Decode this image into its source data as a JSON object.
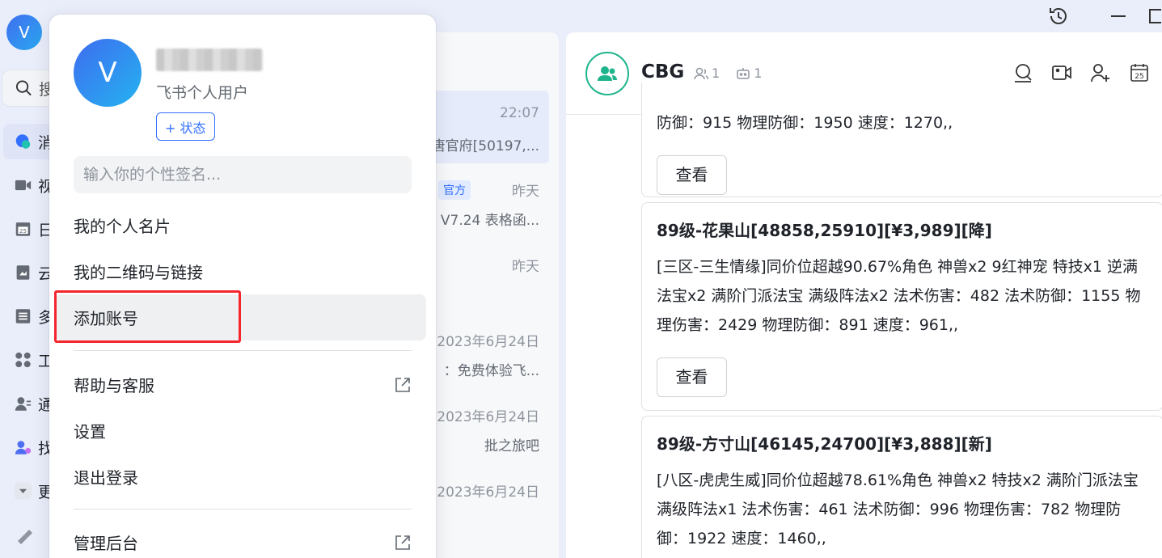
{
  "window": {
    "history_icon": "history-icon",
    "minimize_icon": "minimize-icon",
    "maximize_icon": "maximize-icon"
  },
  "rail": {
    "avatar_letter": "V",
    "search_label": "搜",
    "items": [
      {
        "icon": "messages-icon",
        "label": "消"
      },
      {
        "icon": "video-icon",
        "label": "视"
      },
      {
        "icon": "calendar-icon",
        "label": "日"
      },
      {
        "icon": "docs-icon",
        "label": "云"
      },
      {
        "icon": "list-icon",
        "label": "多"
      },
      {
        "icon": "apps-icon",
        "label": "工"
      },
      {
        "icon": "contacts-icon",
        "label": "通"
      },
      {
        "icon": "add-contact-icon",
        "label": "找"
      },
      {
        "icon": "more-icon",
        "label": "更"
      },
      {
        "icon": "pin-icon",
        "label": ""
      }
    ]
  },
  "chatlist": {
    "rows": [
      {
        "time": "22:07",
        "snippet": "唐官府[50197,..."
      },
      {
        "badge": "官方",
        "time": "昨天",
        "snippet": "V7.24 表格函..."
      },
      {
        "time": "昨天",
        "snippet": ""
      },
      {
        "time": "2023年6月24日",
        "snippet": "：免费体验飞..."
      },
      {
        "time": "2023年6月24日",
        "snippet": "批之旅吧"
      },
      {
        "time": "2023年6月24日",
        "snippet": ""
      }
    ]
  },
  "chat": {
    "group_avatar_icon": "group-icon",
    "name": "CBG",
    "member_count": "1",
    "bot_count": "1",
    "header_icons": [
      "search-chat-icon",
      "video-call-icon",
      "add-member-icon",
      "calendar-icon"
    ],
    "partial_top_text": "防御：915 物理防御：1950 速度：1270,,",
    "view_label": "查看",
    "messages": [
      {
        "title": "89级-花果山[48858,25910][¥3,989][降]",
        "body": "[三区-三生情缘]同价位超越90.67%角色 神兽x2 9红神宠 特技x1 逆满法宝x2 满阶门派法宝 满级阵法x2 法术伤害：482 法术防御：1155 物理伤害：2429 物理防御：891 速度：961,,"
      },
      {
        "title": "89级-方寸山[46145,24700][¥3,888][新]",
        "body": "[八区-虎虎生威]同价位超越78.61%角色 神兽x2 特技x2 满阶门派法宝 满级阵法x1 法术伤害：461 法术防御：996 物理伤害：782 物理防御：1922 速度：1460,,"
      }
    ]
  },
  "profile": {
    "avatar_letter": "V",
    "user_type": "飞书个人用户",
    "status_label": "+ 状态",
    "signature_placeholder": "输入你的个性签名...",
    "menu": {
      "card": "我的个人名片",
      "qrcode": "我的二维码与链接",
      "add_account": "添加账号",
      "help": "帮助与客服",
      "settings": "设置",
      "logout": "退出登录",
      "admin": "管理后台"
    }
  },
  "colors": {
    "accent": "#3370ff",
    "highlight_box": "#f4252c",
    "group_green": "#1fb58c"
  }
}
